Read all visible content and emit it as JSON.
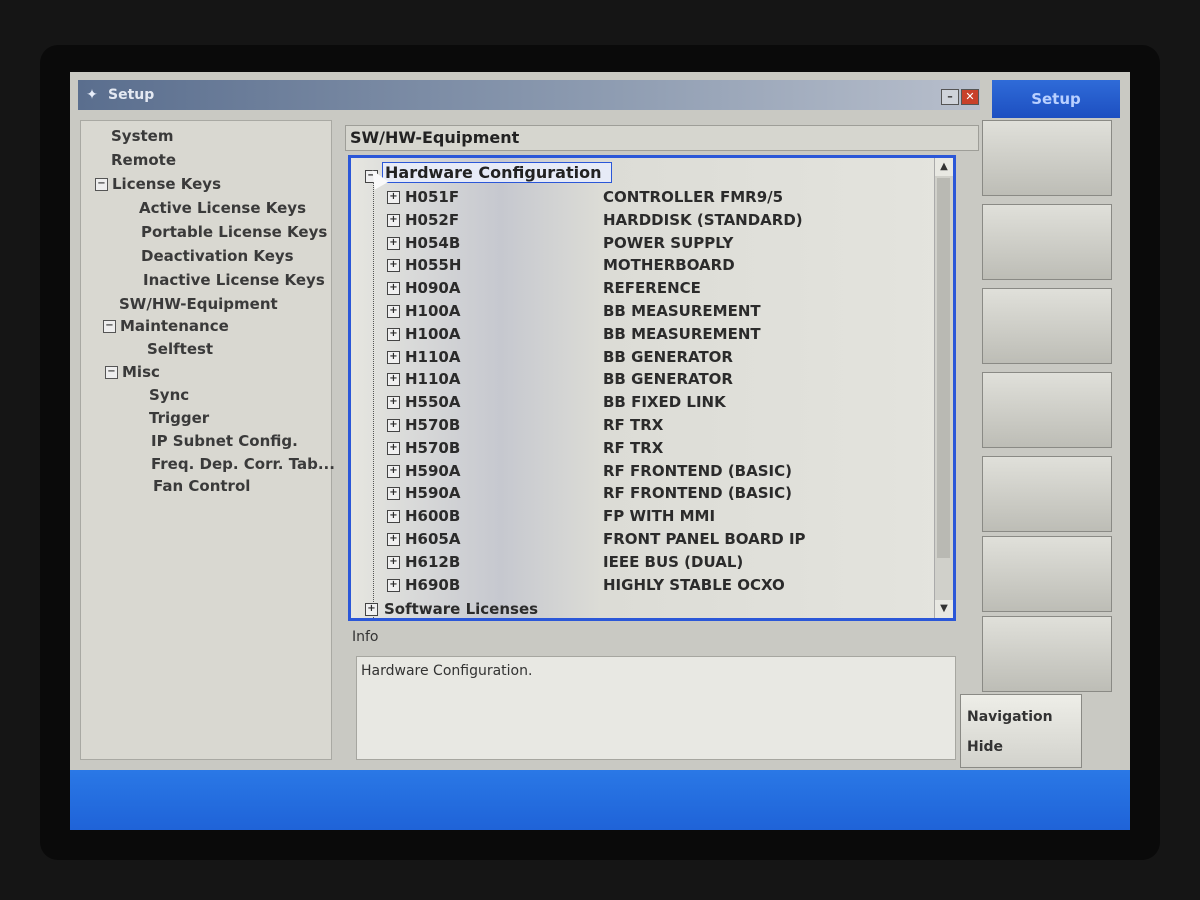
{
  "window": {
    "title": "Setup"
  },
  "softkeys": {
    "title": "Setup",
    "navigation_line1": "Navigation",
    "navigation_line2": "Hide"
  },
  "nav": {
    "items": [
      {
        "label": "System",
        "expander": ""
      },
      {
        "label": "Remote",
        "expander": ""
      },
      {
        "label": "License Keys",
        "expander": "−"
      },
      {
        "label": "Active License Keys",
        "expander": ""
      },
      {
        "label": "Portable License Keys",
        "expander": ""
      },
      {
        "label": "Deactivation Keys",
        "expander": ""
      },
      {
        "label": "Inactive License Keys",
        "expander": ""
      },
      {
        "label": "SW/HW-Equipment",
        "expander": ""
      },
      {
        "label": "Maintenance",
        "expander": "−"
      },
      {
        "label": "Selftest",
        "expander": ""
      },
      {
        "label": "Misc",
        "expander": "−"
      },
      {
        "label": "Sync",
        "expander": ""
      },
      {
        "label": "Trigger",
        "expander": ""
      },
      {
        "label": "IP Subnet Config.",
        "expander": ""
      },
      {
        "label": "Freq. Dep. Corr. Tab...",
        "expander": ""
      },
      {
        "label": "Fan Control",
        "expander": ""
      }
    ]
  },
  "panel": {
    "title": "SW/HW-Equipment",
    "tree_root": "Hardware Configuration",
    "tree_root_expander": "−",
    "rows": [
      {
        "code": "H051F",
        "desc": "CONTROLLER FMR9/5"
      },
      {
        "code": "H052F",
        "desc": "HARDDISK (STANDARD)"
      },
      {
        "code": "H054B",
        "desc": "POWER SUPPLY"
      },
      {
        "code": "H055H",
        "desc": "MOTHERBOARD"
      },
      {
        "code": "H090A",
        "desc": "REFERENCE"
      },
      {
        "code": "H100A",
        "desc": "BB MEASUREMENT"
      },
      {
        "code": "H100A",
        "desc": "BB MEASUREMENT"
      },
      {
        "code": "H110A",
        "desc": "BB GENERATOR"
      },
      {
        "code": "H110A",
        "desc": "BB GENERATOR"
      },
      {
        "code": "H550A",
        "desc": "BB FIXED LINK"
      },
      {
        "code": "H570B",
        "desc": "RF TRX"
      },
      {
        "code": "H570B",
        "desc": "RF TRX"
      },
      {
        "code": "H590A",
        "desc": "RF FRONTEND (BASIC)"
      },
      {
        "code": "H590A",
        "desc": "RF FRONTEND (BASIC)"
      },
      {
        "code": "H600B",
        "desc": "FP WITH MMI"
      },
      {
        "code": "H605A",
        "desc": "FRONT PANEL BOARD IP"
      },
      {
        "code": "H612B",
        "desc": "IEEE BUS (DUAL)"
      },
      {
        "code": "H690B",
        "desc": "HIGHLY STABLE OCXO"
      }
    ],
    "row_expander": "+",
    "software_licenses": "Software Licenses",
    "software_expander": "+",
    "info_label": "Info",
    "info_text": "Hardware Configuration."
  }
}
